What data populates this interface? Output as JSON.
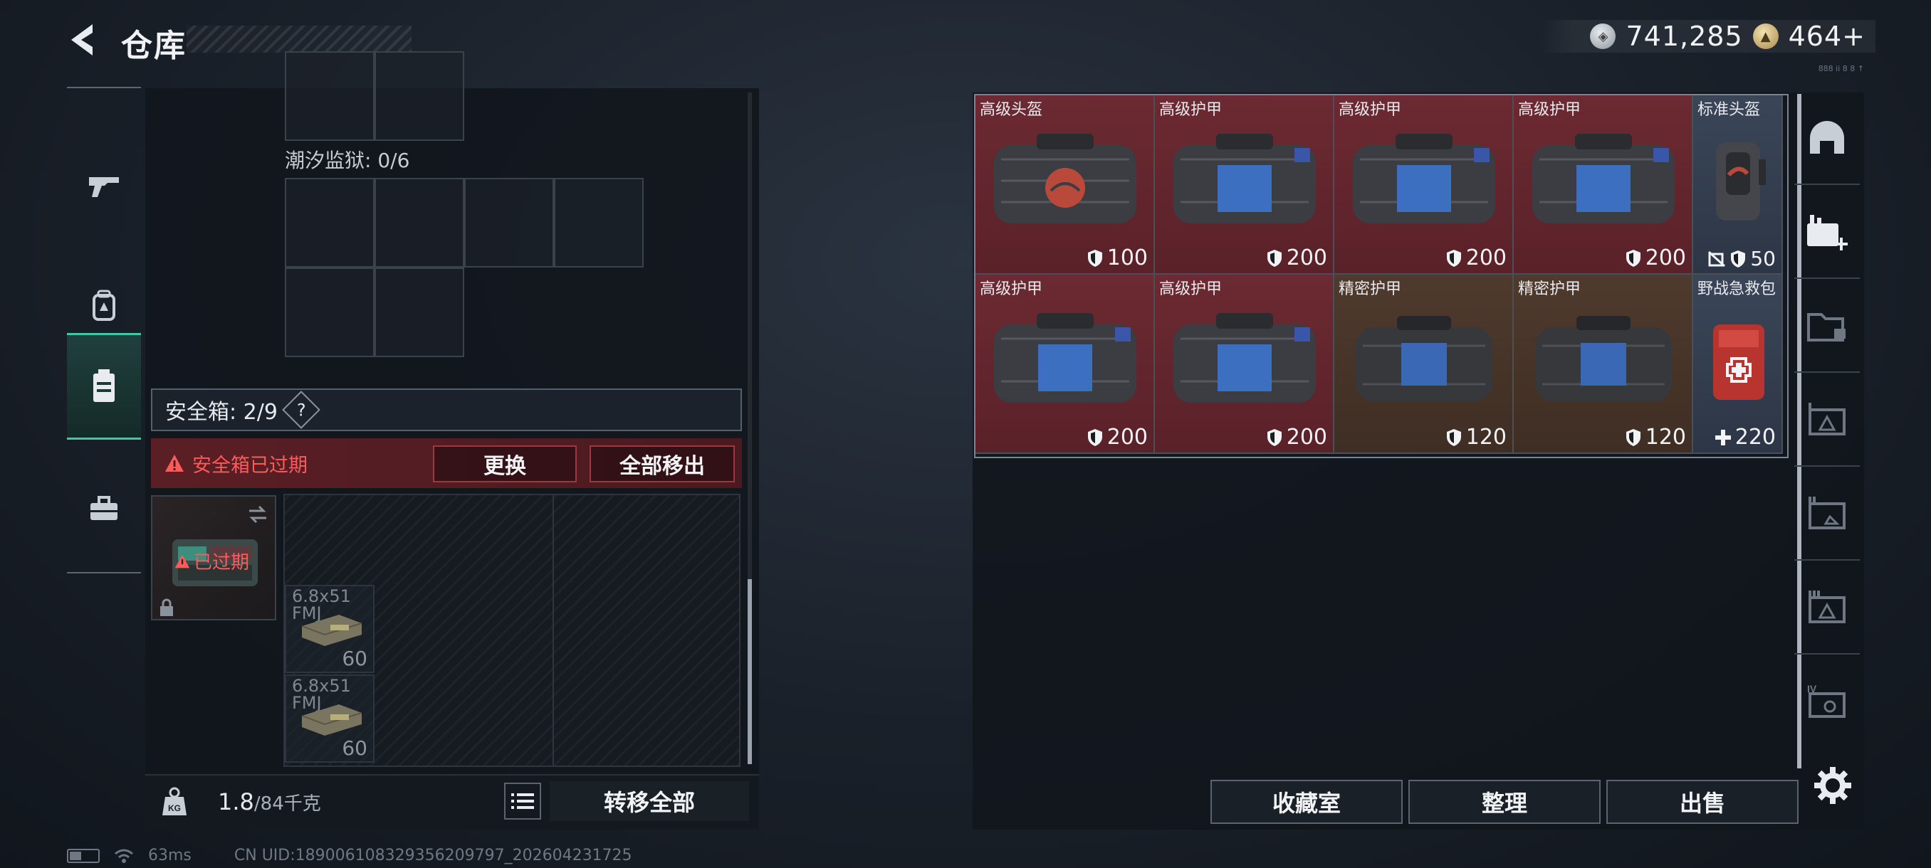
{
  "header": {
    "title": "仓库",
    "currency": [
      {
        "icon": "silver-coin-icon",
        "value": "741,285"
      },
      {
        "icon": "gold-coin-icon",
        "value": "464+"
      }
    ],
    "tiny_code": "888 ii 8 8 ↑"
  },
  "left_rail": {
    "items": [
      {
        "name": "weapons",
        "icon": "gun-icon"
      },
      {
        "name": "equipment",
        "icon": "backpack-icon"
      },
      {
        "name": "containers",
        "icon": "safe-box-icon",
        "active": true
      },
      {
        "name": "misc",
        "icon": "toolbox-icon"
      }
    ]
  },
  "storage": {
    "prison_label": "潮汐监狱: 0/6",
    "safe_title": "安全箱: 2/9",
    "help": "?",
    "expired_message": "安全箱已过期",
    "replace_label": "更换",
    "remove_all_label": "全部移出",
    "case_expired_label": "已过期",
    "ammo": [
      {
        "label": "6.8x51 FMJ",
        "count": "60"
      },
      {
        "label": "6.8x51 FMJ",
        "count": "60"
      }
    ]
  },
  "footer_left": {
    "weight_value": "1.8",
    "weight_capacity": "/84千克",
    "transfer_all_label": "转移全部",
    "weight_icon_text": "KG"
  },
  "items": [
    {
      "name": "高级头盔",
      "value": "100",
      "icon": "shield-icon",
      "color": "red"
    },
    {
      "name": "高级护甲",
      "value": "200",
      "icon": "shield-icon",
      "color": "red"
    },
    {
      "name": "高级护甲",
      "value": "200",
      "icon": "shield-icon",
      "color": "red"
    },
    {
      "name": "高级护甲",
      "value": "200",
      "icon": "shield-icon",
      "color": "red"
    },
    {
      "name": "标准头盔",
      "value": "50",
      "icon": "shield-icon",
      "color": "blue"
    },
    {
      "name": "高级护甲",
      "value": "200",
      "icon": "shield-icon",
      "color": "red"
    },
    {
      "name": "高级护甲",
      "value": "200",
      "icon": "shield-icon",
      "color": "red"
    },
    {
      "name": "精密护甲",
      "value": "120",
      "icon": "shield-icon",
      "color": "orange"
    },
    {
      "name": "精密护甲",
      "value": "120",
      "icon": "shield-icon",
      "color": "orange"
    },
    {
      "name": "野战急救包",
      "value": "220",
      "icon": "plus-icon",
      "color": "blue"
    }
  ],
  "right_rail": {
    "items": [
      {
        "name": "helmet-filter",
        "icon": "helmet-icon"
      },
      {
        "name": "medical-filter",
        "icon": "medkit-plus-icon"
      },
      {
        "name": "folder-filter",
        "icon": "folder-icon"
      },
      {
        "name": "armor-filter-1",
        "icon": "armor-tier-icon"
      },
      {
        "name": "armor-filter-2",
        "icon": "armor-tier-icon"
      },
      {
        "name": "armor-filter-3",
        "icon": "armor-tier-icon"
      },
      {
        "name": "armor-filter-4",
        "icon": "armor-tier-icon"
      }
    ]
  },
  "right_footer": {
    "collection_label": "收藏室",
    "sort_label": "整理",
    "sell_label": "出售"
  },
  "status": {
    "ping": "63ms",
    "uid": "CN UID:1890061083293562097​97_202604231725"
  },
  "colors": {
    "accent": "#41c8a3",
    "danger": "#ff5a5a",
    "red_item": "#6c2a32",
    "orange_item": "#4f3a2d",
    "blue_item": "#3a4658"
  }
}
